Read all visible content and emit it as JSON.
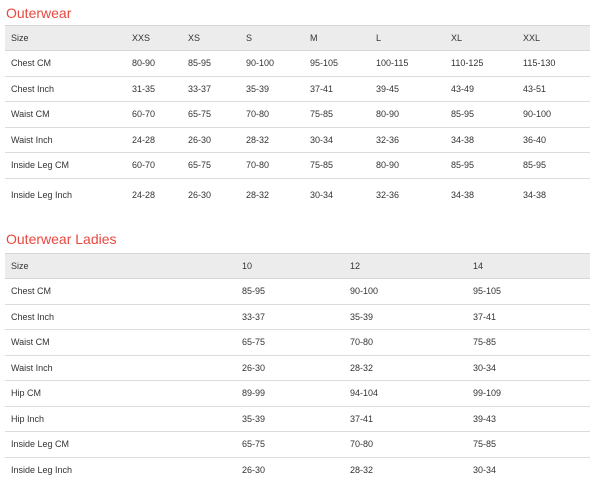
{
  "outerwear": {
    "title": "Outerwear",
    "headers": [
      "Size",
      "XXS",
      "XS",
      "S",
      "M",
      "L",
      "XL",
      "XXL"
    ],
    "rows": [
      [
        "Chest CM",
        "80-90",
        "85-95",
        "90-100",
        "95-105",
        "100-115",
        "110-125",
        "115-130"
      ],
      [
        "Chest Inch",
        "31-35",
        "33-37",
        "35-39",
        "37-41",
        "39-45",
        "43-49",
        "43-51"
      ],
      [
        "Waist CM",
        "60-70",
        "65-75",
        "70-80",
        "75-85",
        "80-90",
        "85-95",
        "90-100"
      ],
      [
        "Waist Inch",
        "24-28",
        "26-30",
        "28-32",
        "30-34",
        "32-36",
        "34-38",
        "36-40"
      ],
      [
        "Inside Leg CM",
        "60-70",
        "65-75",
        "70-80",
        "75-85",
        "80-90",
        "85-95",
        "85-95"
      ],
      [
        "Inside Leg Inch",
        "24-28",
        "26-30",
        "28-32",
        "30-34",
        "32-36",
        "34-38",
        "34-38"
      ]
    ]
  },
  "outerwear_ladies": {
    "title": "Outerwear Ladies",
    "headers": [
      "Size",
      "10",
      "12",
      "14"
    ],
    "rows": [
      [
        "Chest CM",
        "85-95",
        "90-100",
        "95-105"
      ],
      [
        "Chest Inch",
        "33-37",
        "35-39",
        "37-41"
      ],
      [
        "Waist CM",
        "65-75",
        "70-80",
        "75-85"
      ],
      [
        "Waist Inch",
        "26-30",
        "28-32",
        "30-34"
      ],
      [
        "Hip CM",
        "89-99",
        "94-104",
        "99-109"
      ],
      [
        "Hip Inch",
        "35-39",
        "37-41",
        "39-43"
      ],
      [
        "Inside Leg CM",
        "65-75",
        "70-80",
        "75-85"
      ],
      [
        "Inside Leg Inch",
        "26-30",
        "28-32",
        "30-34"
      ]
    ]
  }
}
